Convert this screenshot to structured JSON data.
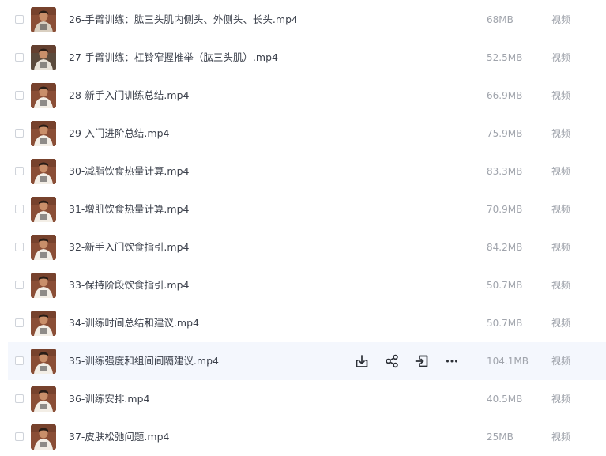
{
  "files": [
    {
      "name": "26-手臂训练：肱三头肌内侧头、外侧头、长头.mp4",
      "size": "68MB",
      "type": "视频"
    },
    {
      "name": "27-手臂训练：杠铃窄握推举（肱三头肌）.mp4",
      "size": "52.5MB",
      "type": "视频"
    },
    {
      "name": "28-新手入门训练总结.mp4",
      "size": "66.9MB",
      "type": "视频"
    },
    {
      "name": "29-入门进阶总结.mp4",
      "size": "75.9MB",
      "type": "视频"
    },
    {
      "name": "30-减脂饮食热量计算.mp4",
      "size": "83.3MB",
      "type": "视频"
    },
    {
      "name": "31-增肌饮食热量计算.mp4",
      "size": "70.9MB",
      "type": "视频"
    },
    {
      "name": "32-新手入门饮食指引.mp4",
      "size": "84.2MB",
      "type": "视频"
    },
    {
      "name": "33-保持阶段饮食指引.mp4",
      "size": "50.7MB",
      "type": "视频"
    },
    {
      "name": "34-训练时间总结和建议.mp4",
      "size": "50.7MB",
      "type": "视频"
    },
    {
      "name": "35-训练强度和组间间隔建议.mp4",
      "size": "104.1MB",
      "type": "视频"
    },
    {
      "name": "36-训练安排.mp4",
      "size": "40.5MB",
      "type": "视频"
    },
    {
      "name": "37-皮肤松弛问题.mp4",
      "size": "25MB",
      "type": "视频"
    }
  ],
  "hovered_row": 9,
  "row_actions": [
    "download-icon",
    "share-icon",
    "move-icon",
    "more-icon"
  ],
  "colors": {
    "hover_bg": "#f4f7fd",
    "name_text": "#3a3f4a",
    "meta_text": "#a0a4ac",
    "icon": "#2b2f36"
  }
}
